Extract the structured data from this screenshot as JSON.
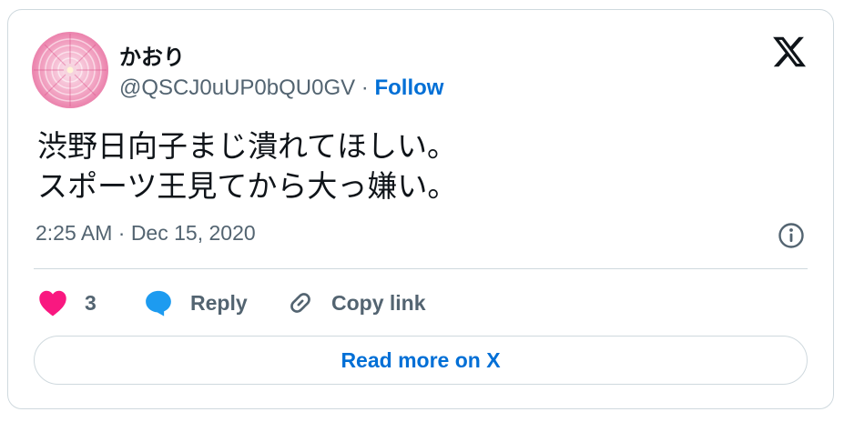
{
  "tweet": {
    "author": {
      "display_name": "かおり",
      "handle": "@QSCJ0uUP0bQU0GV",
      "separator": " · ",
      "follow_label": "Follow",
      "avatar_icon": "pink-dahlia-flower-avatar"
    },
    "brand_icon": "x-logo-icon",
    "text_lines": [
      "渋野日向子まじ潰れてほしい。",
      "スポーツ王見てから大っ嫌い。"
    ],
    "timestamp": "2:25 AM · Dec 15, 2020",
    "info_icon": "info-icon",
    "actions": {
      "like_count": "3",
      "reply_label": "Reply",
      "copy_label": "Copy link"
    },
    "read_more_label": "Read more on X"
  },
  "colors": {
    "text_primary": "#0f1419",
    "text_secondary": "#536471",
    "link_blue": "#006fd6",
    "like_pink": "#f91880",
    "reply_blue": "#1d9bf0",
    "border": "#cfd9de"
  }
}
